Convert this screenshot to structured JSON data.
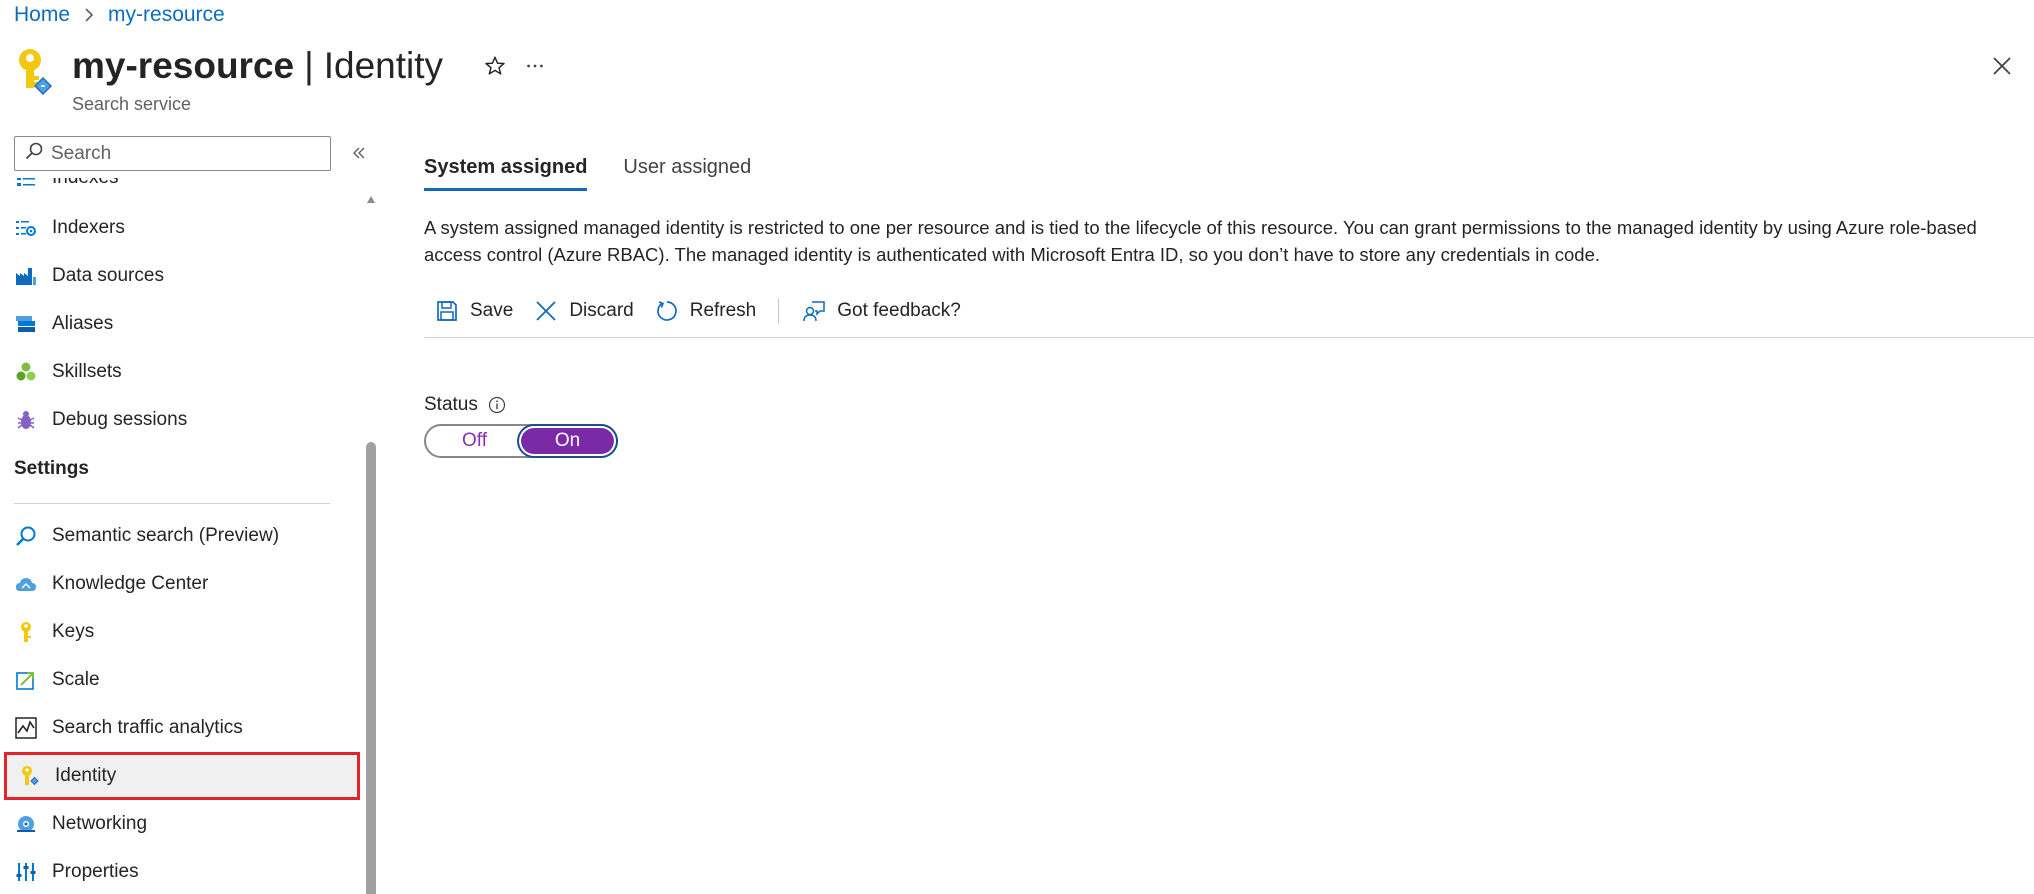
{
  "breadcrumb": {
    "home": "Home",
    "resource": "my-resource"
  },
  "header": {
    "resource_name": "my-resource",
    "separator": "|",
    "page_name": "Identity",
    "subtitle": "Search service"
  },
  "sidebar": {
    "search_placeholder": "Search",
    "items_top": [
      {
        "label": "Indexes",
        "icon": "indexes-icon"
      },
      {
        "label": "Indexers",
        "icon": "indexers-icon"
      },
      {
        "label": "Data sources",
        "icon": "data-sources-icon"
      },
      {
        "label": "Aliases",
        "icon": "aliases-icon"
      },
      {
        "label": "Skillsets",
        "icon": "skillsets-icon"
      },
      {
        "label": "Debug sessions",
        "icon": "debug-icon"
      }
    ],
    "settings_heading": "Settings",
    "settings_items": [
      {
        "label": "Semantic search (Preview)",
        "icon": "semantic-search-icon"
      },
      {
        "label": "Knowledge Center",
        "icon": "knowledge-center-icon"
      },
      {
        "label": "Keys",
        "icon": "key-icon"
      },
      {
        "label": "Scale",
        "icon": "scale-icon"
      },
      {
        "label": "Search traffic analytics",
        "icon": "analytics-icon"
      },
      {
        "label": "Identity",
        "icon": "identity-icon",
        "selected": true
      },
      {
        "label": "Networking",
        "icon": "networking-icon"
      },
      {
        "label": "Properties",
        "icon": "properties-icon"
      }
    ]
  },
  "main": {
    "tabs": [
      {
        "label": "System assigned",
        "active": true
      },
      {
        "label": "User assigned",
        "active": false
      }
    ],
    "description": "A system assigned managed identity is restricted to one per resource and is tied to the lifecycle of this resource. You can grant permissions to the managed identity by using Azure role-based access control (Azure RBAC). The managed identity is authenticated with Microsoft Entra ID, so you don’t have to store any credentials in code.",
    "toolbar": {
      "save": "Save",
      "discard": "Discard",
      "refresh": "Refresh",
      "feedback": "Got feedback?"
    },
    "status": {
      "label": "Status",
      "off": "Off",
      "on": "On",
      "value": "On"
    }
  },
  "colors": {
    "link": "#0f6cbd",
    "toggle_on": "#7a2aa6",
    "selected_outline": "#e3242b"
  }
}
